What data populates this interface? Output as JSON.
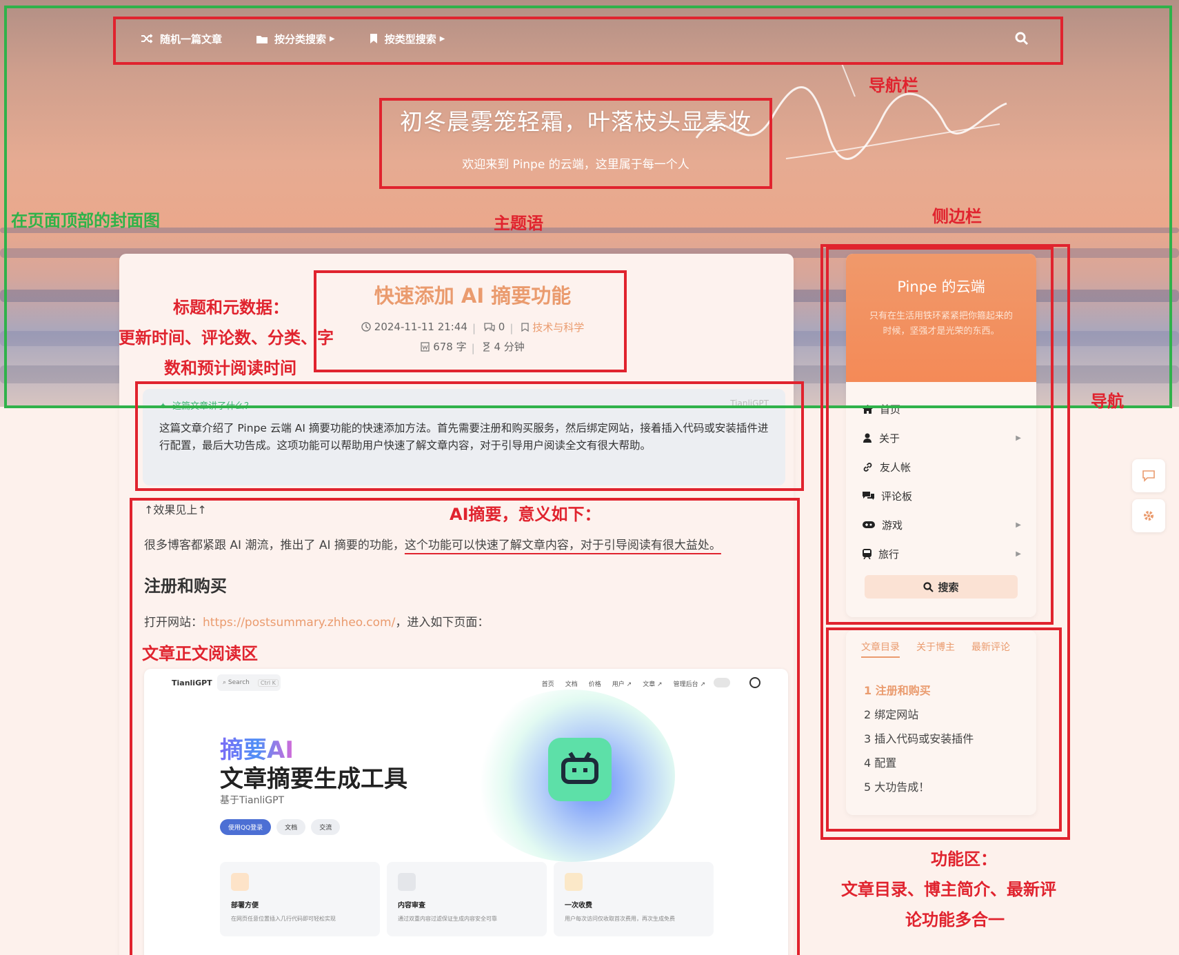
{
  "nav": {
    "items": [
      {
        "label": "随机一篇文章",
        "icon": "shuffle-icon",
        "dropdown": false
      },
      {
        "label": "按分类搜索",
        "icon": "folder-icon",
        "dropdown": true
      },
      {
        "label": "按类型搜索",
        "icon": "bookmark-icon",
        "dropdown": true
      }
    ],
    "search_icon": "search-icon"
  },
  "hero": {
    "title": "初冬晨雾笼轻霜，叶落枝头显素妆",
    "subtitle": "欢迎来到 Pinpe 的云端，这里属于每一个人"
  },
  "post": {
    "title": "快速添加 AI 摘要功能",
    "updated": "2024-11-11 21:44",
    "comments": "0",
    "category": "技术与科学",
    "words": "678 字",
    "read_time": "4 分钟"
  },
  "summary": {
    "heading": "这篇文章讲了什么？",
    "brand": "TianliGPT",
    "text": "这篇文章介绍了 Pinpe 云端 AI 摘要功能的快速添加方法。首先需要注册和购买服务，然后绑定网站，接着插入代码或安装插件进行配置，最后大功告成。这项功能可以帮助用户快速了解文章内容，对于引导用户阅读全文有很大帮助。"
  },
  "body": {
    "effect_note": "↑效果见上↑",
    "para1_a": "很多博客都紧跟 AI 潮流，推出了 AI 摘要的功能，",
    "para1_b": "这个功能可以快速了解文章内容，对于引导阅读有很大益处。",
    "section1": "注册和购买",
    "para2_a": "打开网站：",
    "para2_link": "https://postsummary.zhheo.com/",
    "para2_b": "，进入如下页面："
  },
  "shot": {
    "logo": "TianliGPT",
    "search": "Search",
    "search_key": "Ctrl K",
    "links": [
      "首页",
      "文档",
      "价格",
      "用户 ↗",
      "文章 ↗",
      "管理后台 ↗"
    ],
    "h1a": "摘要AI",
    "h1b": "文章摘要生成工具",
    "sub": "基于TianliGPT",
    "btn_primary": "使用QQ登录",
    "btn_doc": "文档",
    "btn_chat": "交流",
    "cards": [
      {
        "title": "部署方便",
        "desc": "在网页任意位置插入几行代码即可轻松实现"
      },
      {
        "title": "内容审查",
        "desc": "通过双重内容过滤保证生成内容安全可靠"
      },
      {
        "title": "一次收费",
        "desc": "用户每次访问仅收取首次费用，再次生成免费"
      }
    ]
  },
  "sidebar": {
    "site_title": "Pinpe 的云端",
    "site_desc": "只有在生活用铁环紧紧把你箍起来的时候，坚强才是光荣的东西。",
    "menu": [
      {
        "label": "首页",
        "icon": "home-icon",
        "sub": false
      },
      {
        "label": "关于",
        "icon": "user-icon",
        "sub": true
      },
      {
        "label": "友人帐",
        "icon": "link-icon",
        "sub": false
      },
      {
        "label": "评论板",
        "icon": "comments-icon",
        "sub": false
      },
      {
        "label": "游戏",
        "icon": "gamepad-icon",
        "sub": true
      },
      {
        "label": "旅行",
        "icon": "train-icon",
        "sub": true
      }
    ],
    "search_label": "搜索"
  },
  "widget": {
    "tabs": [
      "文章目录",
      "关于博主",
      "最新评论"
    ],
    "toc": [
      "1 注册和购买",
      "2 绑定网站",
      "3 插入代码或安装插件",
      "4 配置",
      "5 大功告成！"
    ]
  },
  "annotations": {
    "cover": "在页面顶部的封面图",
    "nav": "导航栏",
    "motto": "主题语",
    "sidebar": "侧边栏",
    "menu": "导航",
    "meta_1": "标题和元数据：",
    "meta_2": "更新时间、评论数、分类、字",
    "meta_3": "数和预计阅读时间",
    "ai": "AI摘要，意义如下：",
    "reading": "文章正文阅读区",
    "func_1": "功能区：",
    "func_2": "文章目录、博主简介、最新评",
    "func_3": "论功能多合一"
  },
  "colors": {
    "accent": "#ea9b6e",
    "annotation_red": "#e0232e",
    "annotation_green": "#2fb24a"
  }
}
